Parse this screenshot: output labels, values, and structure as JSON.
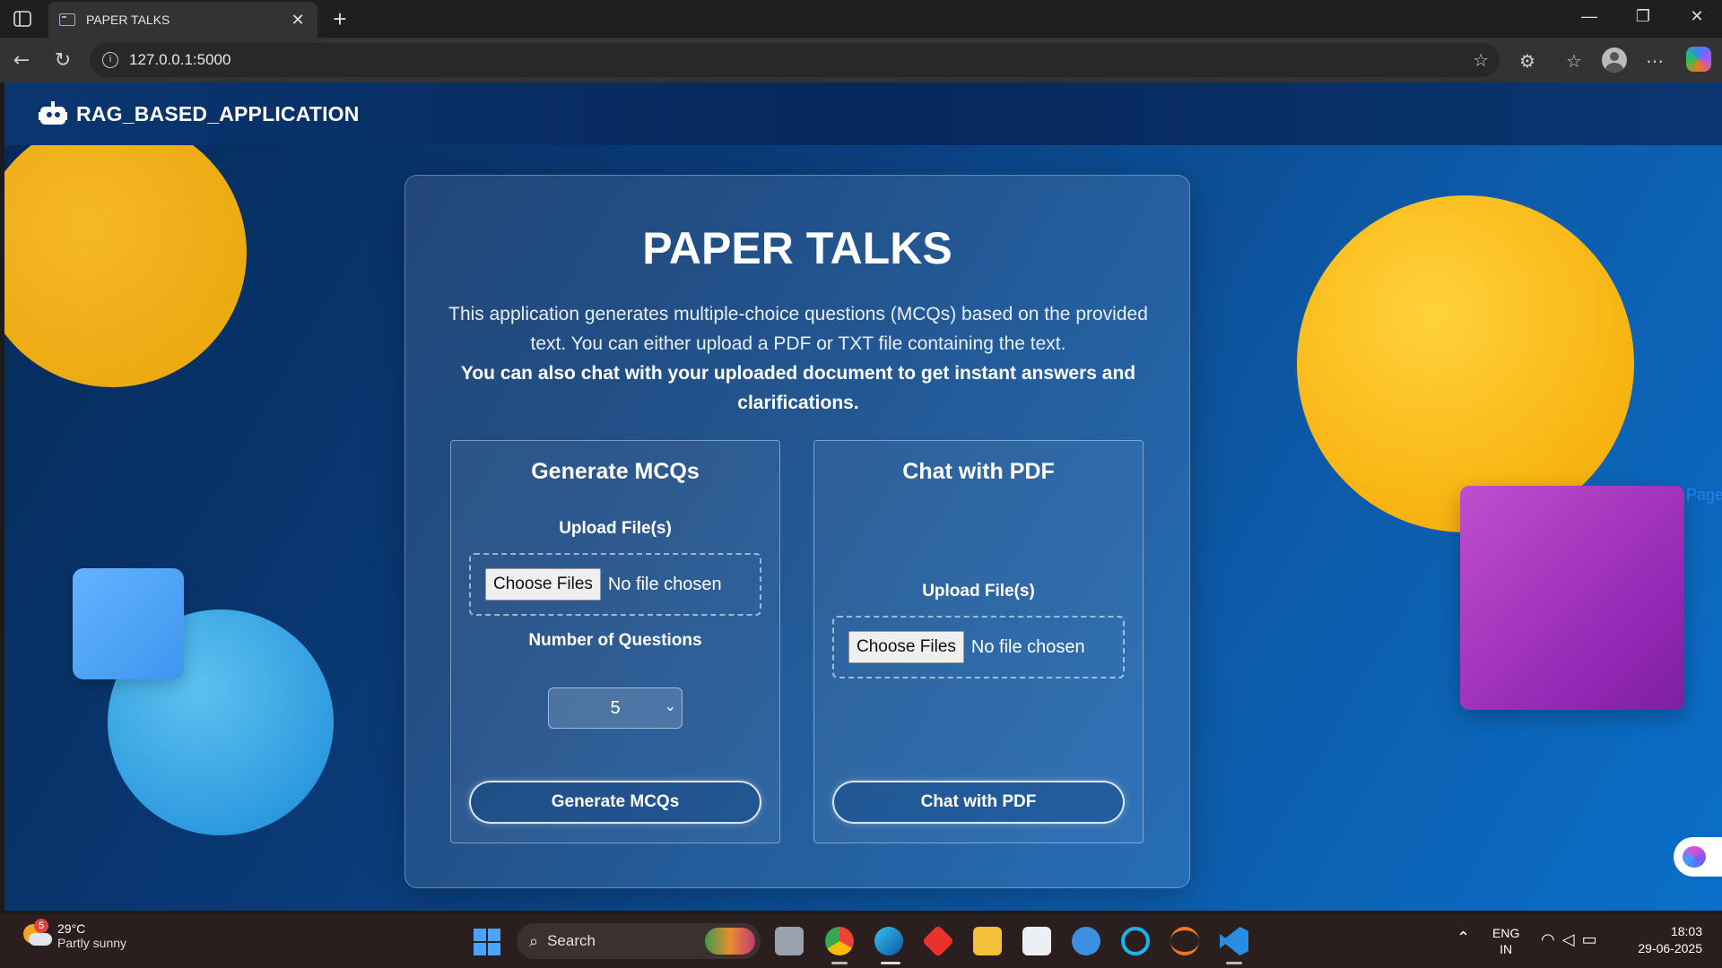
{
  "browser": {
    "tab_title": "PAPER TALKS",
    "tab_close": "✕",
    "new_tab": "+",
    "url": "127.0.0.1:5000",
    "window_controls": {
      "minimize": "—",
      "restore": "❐",
      "close": "✕"
    }
  },
  "navbar": {
    "brand": "RAG_BASED_APPLICATION"
  },
  "main": {
    "title": "PAPER TALKS",
    "description": "This application generates multiple-choice questions (MCQs) based on the provided text. You can either upload a PDF or TXT file containing the text.",
    "description_bold": "You can also chat with your uploaded document to get instant answers and clarifications."
  },
  "mcq_panel": {
    "heading": "Generate MCQs",
    "upload_label": "Upload File(s)",
    "choose_button": "Choose Files",
    "file_status": "No file chosen",
    "questions_label": "Number of Questions",
    "questions_value": "5",
    "action_button": "Generate MCQs"
  },
  "chat_panel": {
    "heading": "Chat with PDF",
    "upload_label": "Upload File(s)",
    "choose_button": "Choose Files",
    "file_status": "No file chosen",
    "action_button": "Chat with PDF"
  },
  "page_peek_text": "Page",
  "taskbar": {
    "weather_temp": "29°C",
    "weather_desc": "Partly sunny",
    "weather_badge": "5",
    "search_label": "Search",
    "lang_top": "ENG",
    "lang_bottom": "IN",
    "time": "18:03",
    "date": "29-06-2025"
  },
  "colors": {
    "accent_yellow": "#f7b310",
    "accent_purple": "#9428b4",
    "accent_blue": "#2f9ce0",
    "page_bg": "#0a3a77"
  },
  "icons": [
    "sidebar-toggle-icon",
    "favicon-icon",
    "back-icon",
    "refresh-icon",
    "info-icon",
    "star-icon",
    "extensions-icon",
    "favorites-icon",
    "profile-icon",
    "more-icon",
    "copilot-icon",
    "robot-icon",
    "brain-icon",
    "start-icon",
    "search-icon",
    "weather-icon",
    "wifi-icon",
    "volume-icon",
    "battery-icon"
  ]
}
